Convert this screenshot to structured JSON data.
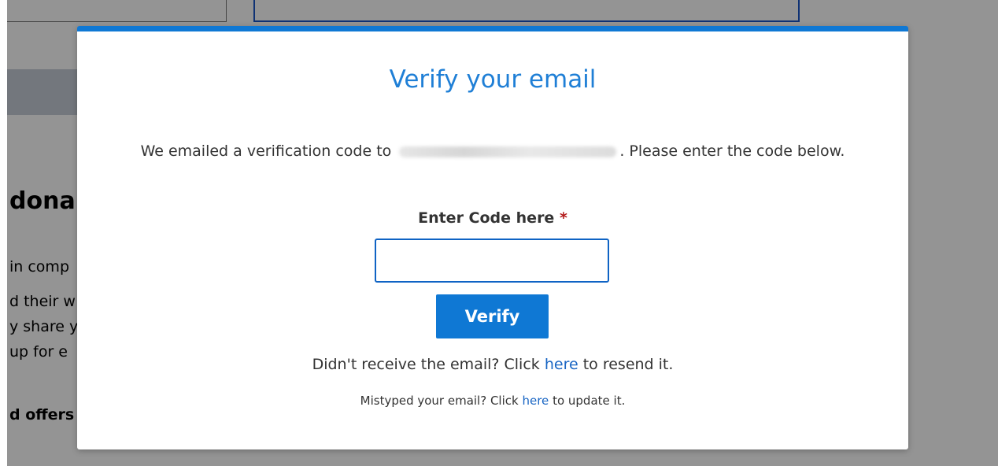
{
  "background": {
    "heading": "dona",
    "lines": [
      "in comp",
      "d their w",
      "y share y",
      "up for e",
      "d offers a"
    ]
  },
  "modal": {
    "title": "Verify your email",
    "intro_before": "We emailed a verification code to",
    "intro_after": ". Please enter the code below.",
    "code_label": "Enter Code here",
    "required_marker": "*",
    "code_input_value": "",
    "verify_label": "Verify",
    "resend_before": "Didn't receive the email? Click",
    "resend_link": "here",
    "resend_after": "to resend it.",
    "update_before": "Mistyped your email? Click",
    "update_link": "here",
    "update_after": "to update it."
  },
  "colors": {
    "accent": "#0f78d4",
    "title": "#1f7fd6",
    "link": "#1a66c4",
    "required": "#b31b1b"
  }
}
